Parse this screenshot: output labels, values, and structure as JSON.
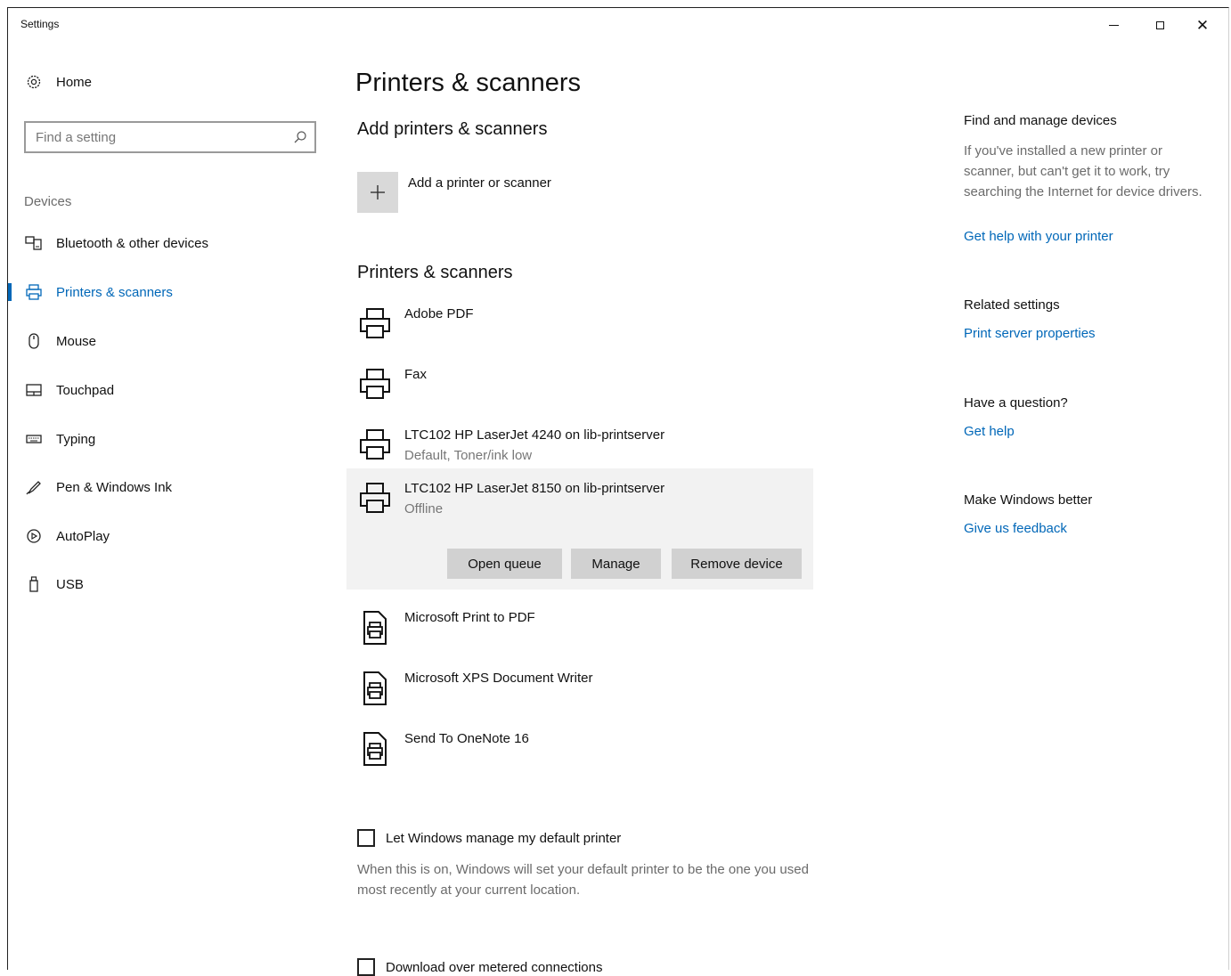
{
  "window": {
    "title": "Settings"
  },
  "nav": {
    "home_label": "Home",
    "search_placeholder": "Find a setting",
    "section_label": "Devices",
    "items": [
      {
        "label": "Bluetooth & other devices",
        "icon": "bluetooth-devices-icon"
      },
      {
        "label": "Printers & scanners",
        "icon": "printer-icon",
        "active": true
      },
      {
        "label": "Mouse",
        "icon": "mouse-icon"
      },
      {
        "label": "Touchpad",
        "icon": "touchpad-icon"
      },
      {
        "label": "Typing",
        "icon": "keyboard-icon"
      },
      {
        "label": "Pen & Windows Ink",
        "icon": "pen-icon"
      },
      {
        "label": "AutoPlay",
        "icon": "autoplay-icon"
      },
      {
        "label": "USB",
        "icon": "usb-icon"
      }
    ]
  },
  "main": {
    "title": "Printers & scanners",
    "add_heading": "Add printers & scanners",
    "add_label": "Add a printer or scanner",
    "list_heading": "Printers & scanners",
    "printers": [
      {
        "name": "Adobe PDF",
        "status": "",
        "icon": "printer-icon"
      },
      {
        "name": "Fax",
        "status": "",
        "icon": "printer-icon"
      },
      {
        "name": "LTC102 HP LaserJet 4240 on lib-printserver",
        "status": "Default, Toner/ink low",
        "icon": "printer-icon"
      },
      {
        "name": "LTC102 HP LaserJet 8150 on lib-printserver",
        "status": "Offline",
        "icon": "printer-icon",
        "selected": true
      },
      {
        "name": "Microsoft Print to PDF",
        "status": "",
        "icon": "document-printer-icon"
      },
      {
        "name": "Microsoft XPS Document Writer",
        "status": "",
        "icon": "document-printer-icon"
      },
      {
        "name": "Send To OneNote 16",
        "status": "",
        "icon": "document-printer-icon"
      }
    ],
    "actions": {
      "open_queue": "Open queue",
      "manage": "Manage",
      "remove": "Remove device"
    },
    "default_printer_label": "Let Windows manage my default printer",
    "default_printer_desc": "When this is on, Windows will set your default printer to be the one you used most recently at your current location.",
    "metered_label": "Download over metered connections"
  },
  "right": {
    "find_title": "Find and manage devices",
    "find_text": "If you've installed a new printer or scanner, but can't get it to work, try searching the Internet for device drivers.",
    "find_link": "Get help with your printer",
    "related_title": "Related settings",
    "related_link": "Print server properties",
    "question_title": "Have a question?",
    "question_link": "Get help",
    "better_title": "Make Windows better",
    "better_link": "Give us feedback"
  },
  "colors": {
    "accent": "#0067b8",
    "selected_bg": "#f2f2f2",
    "button_bg": "#d1d1d1"
  }
}
